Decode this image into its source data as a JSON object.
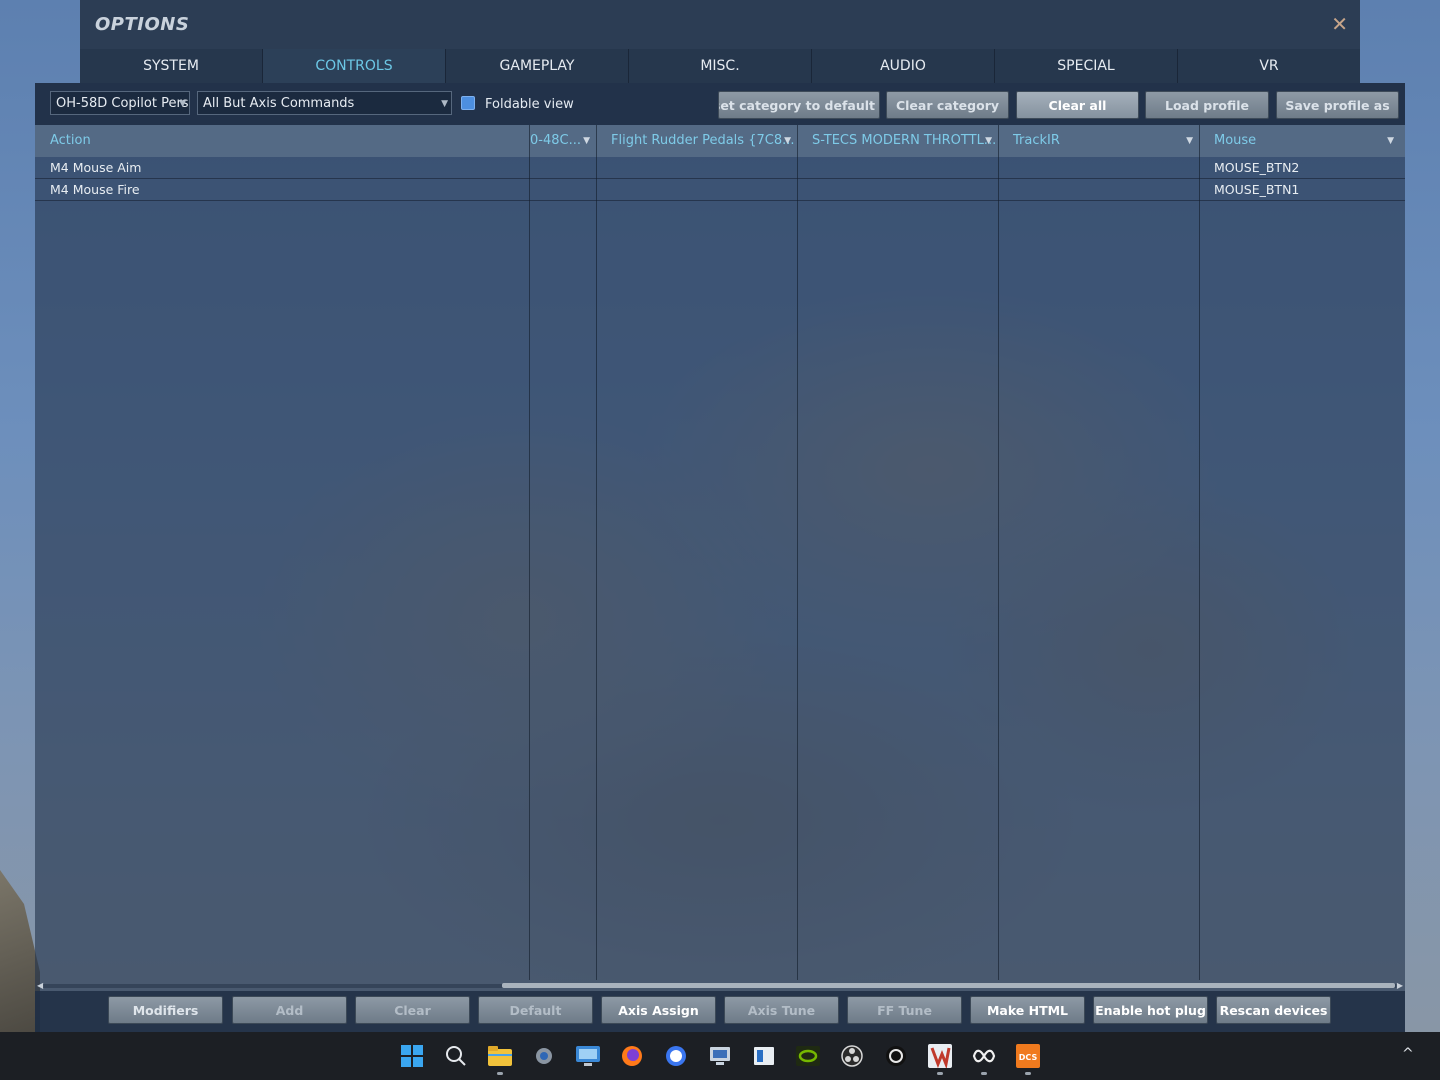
{
  "window": {
    "title": "OPTIONS",
    "close_glyph": "✕"
  },
  "tabs": [
    {
      "label": "SYSTEM",
      "active": false
    },
    {
      "label": "CONTROLS",
      "active": true
    },
    {
      "label": "GAMEPLAY",
      "active": false
    },
    {
      "label": "MISC.",
      "active": false
    },
    {
      "label": "AUDIO",
      "active": false
    },
    {
      "label": "SPECIAL",
      "active": false
    },
    {
      "label": "VR",
      "active": false
    }
  ],
  "toolbar": {
    "aircraft_select": "OH-58D Copilot Pers",
    "category_select": "All But Axis Commands",
    "foldable_view_label": "Foldable view",
    "foldable_view_checked": true,
    "reset_category_label": "Reset category to default",
    "clear_category_label": "Clear category",
    "clear_all_label": "Clear all",
    "load_profile_label": "Load profile",
    "save_profile_label": "Save profile as"
  },
  "table": {
    "headers": [
      "Action",
      "0-48C...",
      "Flight Rudder Pedals {7C8...",
      "S-TECS MODERN THROTTL...",
      "TrackIR",
      "Mouse"
    ],
    "rows": [
      [
        "M4 Mouse Aim",
        "",
        "",
        "",
        "",
        "MOUSE_BTN2"
      ],
      [
        "M4 Mouse Fire",
        "",
        "",
        "",
        "",
        "MOUSE_BTN1"
      ]
    ]
  },
  "bottom_buttons": {
    "modifiers": "Modifiers",
    "add": "Add",
    "clear": "Clear",
    "default": "Default",
    "axis_assign": "Axis Assign",
    "axis_tune": "Axis Tune",
    "ff_tune": "FF Tune",
    "make_html": "Make HTML",
    "enable_hot_plug": "Enable hot plug",
    "rescan_devices": "Rescan devices"
  },
  "taskbar": {
    "icons": [
      "windows-start-icon",
      "search-icon",
      "file-explorer-icon",
      "settings-icon",
      "remote-desktop-icon",
      "firefox-icon",
      "signal-icon",
      "monitor-app-icon",
      "store-app-icon",
      "nvidia-icon",
      "obs-icon",
      "openai-icon",
      "winamp-icon",
      "meta-icon",
      "dcs-icon"
    ],
    "dcs_label": "DCS",
    "tray_chevron": "^"
  },
  "colors": {
    "accent_tab": "#6cc8e6",
    "header_text": "#7ecbe8",
    "close_glyph": "#c7a58a",
    "checkbox": "#4d8fe0"
  }
}
